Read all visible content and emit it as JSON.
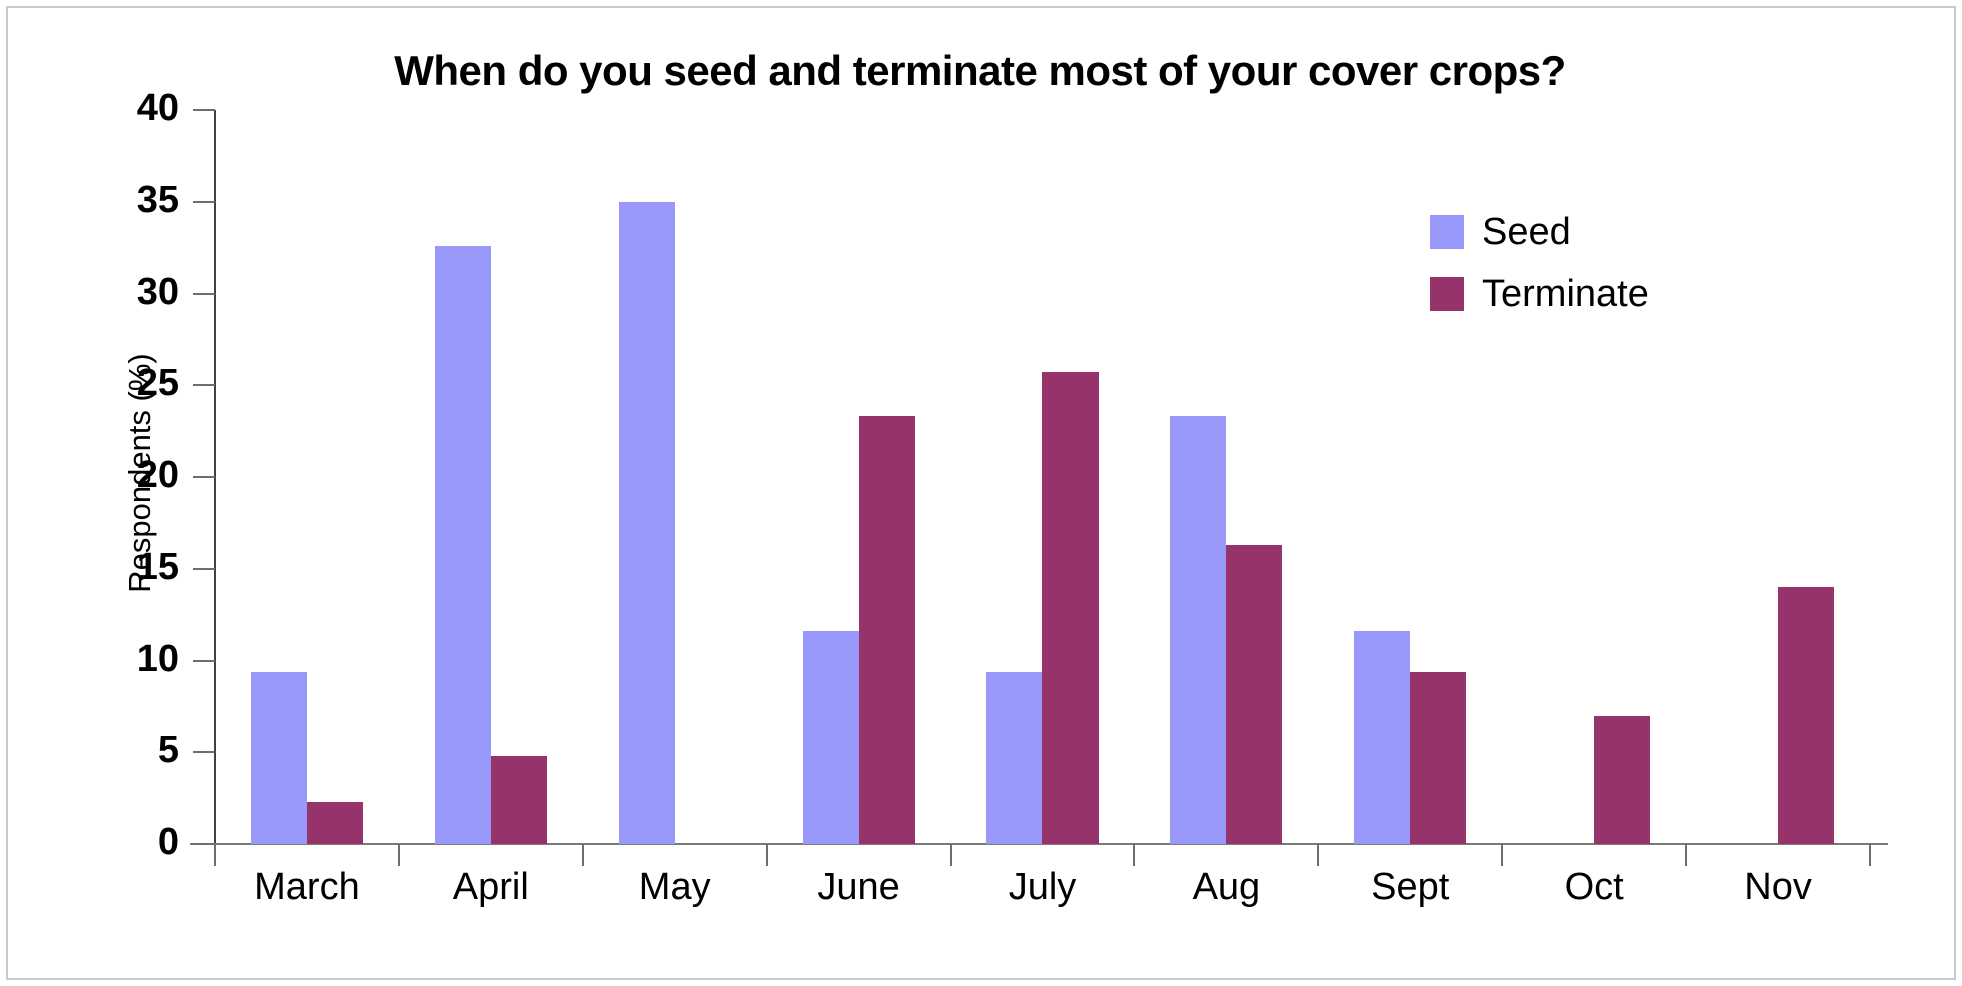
{
  "chart_data": {
    "type": "bar",
    "title": "When do you seed and terminate most of your cover crops?",
    "xlabel": "",
    "ylabel": "Respondents (%)",
    "ylim": [
      0,
      40
    ],
    "yticks": [
      "0",
      "5",
      "10",
      "15",
      "20",
      "25",
      "30",
      "35",
      "40"
    ],
    "grid": false,
    "legend_position": "upper right inside",
    "categories": [
      "March",
      "April",
      "May",
      "June",
      "July",
      "Aug",
      "Sept",
      "Oct",
      "Nov"
    ],
    "series": [
      {
        "name": "Seed",
        "color": "#9999FB",
        "values": [
          9.4,
          32.6,
          35.0,
          11.6,
          9.4,
          23.3,
          11.6,
          0,
          0
        ]
      },
      {
        "name": "Terminate",
        "color": "#96336A",
        "values": [
          2.3,
          4.8,
          0,
          23.3,
          25.7,
          16.3,
          9.4,
          7.0,
          14.0
        ]
      }
    ]
  },
  "legend": {
    "items": [
      {
        "label": "Seed",
        "color": "#9999FB"
      },
      {
        "label": "Terminate",
        "color": "#96336A"
      }
    ]
  }
}
